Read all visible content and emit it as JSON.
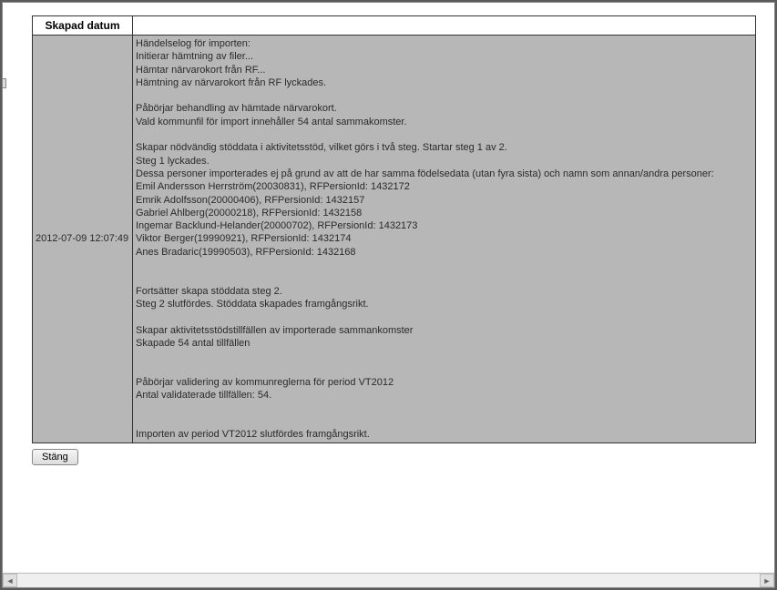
{
  "table": {
    "headers": {
      "date": "Skapad datum",
      "log": ""
    },
    "row": {
      "timestamp": "2012-07-09 12:07:49",
      "log": "Händelselog för importen:\nInitierar hämtning av filer...\nHämtar närvarokort från RF...\nHämtning av närvarokort från RF lyckades.\n\nPåbörjar behandling av hämtade närvarokort.\nVald kommunfil för import innehåller 54 antal sammakomster.\n\nSkapar nödvändig stöddata i aktivitetsstöd, vilket görs i två steg. Startar steg 1 av 2.\nSteg 1 lyckades.\nDessa personer importerades ej på grund av att de har samma födelsedata (utan fyra sista) och namn som annan/andra personer:\nEmil Andersson Herrström(20030831), RFPersionId: 1432172\nEmrik Adolfsson(20000406), RFPersionId: 1432157\nGabriel Ahlberg(20000218), RFPersionId: 1432158\nIngemar Backlund-Helander(20000702), RFPersionId: 1432173\nViktor Berger(19990921), RFPersionId: 1432174\nAnes Bradaric(19990503), RFPersionId: 1432168\n\n\nFortsätter skapa stöddata steg 2.\nSteg 2 slutfördes. Stöddata skapades framgångsrikt.\n\nSkapar aktivitetsstödstillfällen av importerade sammankomster\nSkapade 54 antal tillfällen\n\n\nPåbörjar validering av kommunreglerna för period VT2012\nAntal validaterade tillfällen: 54.\n\n\nImporten av period VT2012 slutfördes framgångsrikt."
    }
  },
  "buttons": {
    "close": "Stäng"
  }
}
